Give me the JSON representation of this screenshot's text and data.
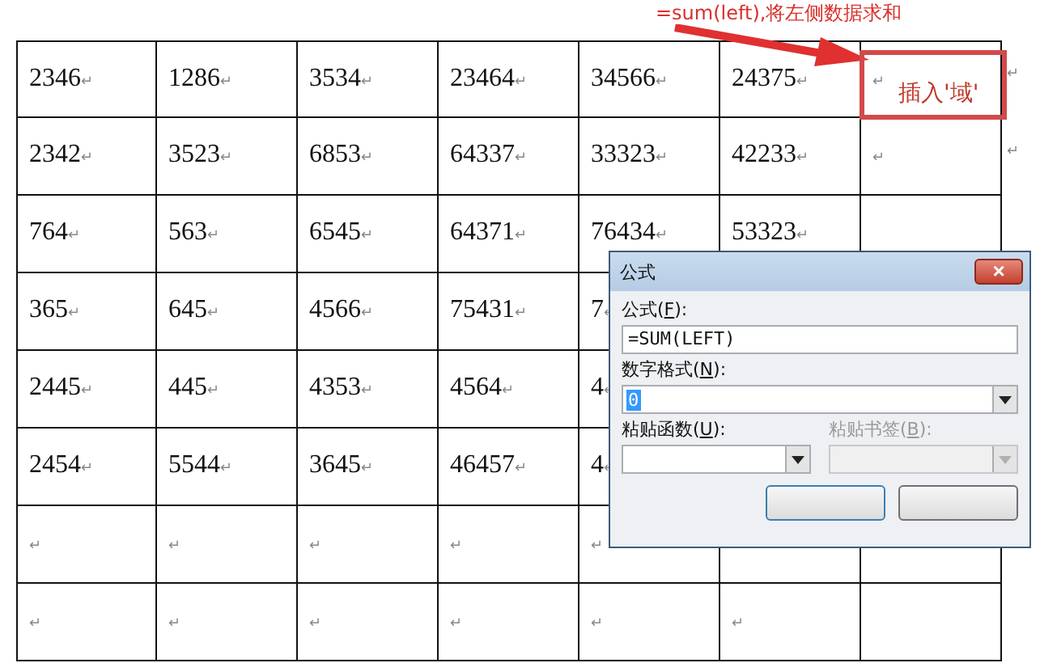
{
  "annotation": {
    "note": "=sum(left),将左侧数据求和",
    "callout": "插入'域'"
  },
  "table": {
    "rows": [
      {
        "cells": [
          "2346",
          "1286",
          "3534",
          "23464",
          "34566",
          "24375",
          ""
        ],
        "end_mark": "↵"
      },
      {
        "cells": [
          "2342",
          "3523",
          "6853",
          "64337",
          "33323",
          "42233",
          ""
        ],
        "end_mark": "↵"
      },
      {
        "cells": [
          "764",
          "563",
          "6545",
          "64371",
          "76434",
          "53323",
          null
        ]
      },
      {
        "cells": [
          "365",
          "645",
          "4566",
          "75431",
          "7"
        ]
      },
      {
        "cells": [
          "2445",
          "445",
          "4353",
          "4564",
          "4"
        ]
      },
      {
        "cells": [
          "2454",
          "5544",
          "3645",
          "46457",
          "4"
        ]
      },
      {
        "cells": [
          "",
          "",
          "",
          "",
          "",
          null,
          null
        ]
      },
      {
        "cells": [
          "",
          "",
          "",
          "",
          "",
          "",
          null
        ]
      }
    ],
    "mark": "↵"
  },
  "dialog": {
    "title": "公式",
    "close": "×",
    "formula": {
      "label": "公式(",
      "key": "F",
      "label_end": "):",
      "value": "=SUM(LEFT)"
    },
    "number_format": {
      "label": "数字格式(",
      "key": "N",
      "label_end": "):",
      "value": "0"
    },
    "paste_function": {
      "label": "粘贴函数(",
      "key": "U",
      "label_end": "):",
      "disabled": false
    },
    "paste_bookmark": {
      "label": "粘贴书签(",
      "key": "B",
      "label_end": "):",
      "disabled": true
    }
  }
}
